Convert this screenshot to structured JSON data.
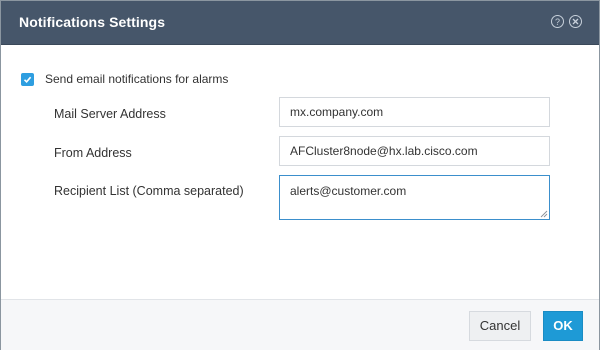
{
  "dialog": {
    "title": "Notifications Settings",
    "help_icon": "help-circle-icon",
    "close_icon": "close-circle-icon"
  },
  "form": {
    "email_alarms": {
      "label": "Send email notifications for alarms",
      "checked": true
    },
    "mail_server": {
      "label": "Mail Server Address",
      "value": "mx.company.com"
    },
    "from_address": {
      "label": "From Address",
      "value": "AFCluster8node@hx.lab.cisco.com"
    },
    "recipients": {
      "label": "Recipient List (Comma separated)",
      "value": "alerts@customer.com"
    }
  },
  "footer": {
    "cancel_label": "Cancel",
    "ok_label": "OK"
  },
  "colors": {
    "header_bg": "#46566a",
    "accent": "#1e9ad6",
    "checkbox": "#2e9ee0",
    "focus_border": "#3b8fcc"
  }
}
